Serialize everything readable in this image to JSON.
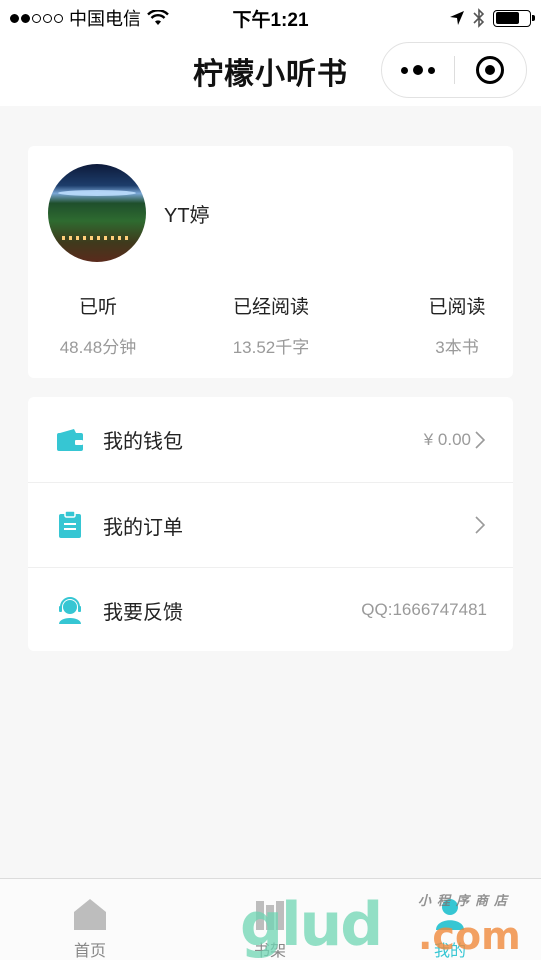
{
  "status_bar": {
    "carrier": "中国电信",
    "time": "下午1:21"
  },
  "nav": {
    "title": "柠檬小听书"
  },
  "profile": {
    "username": "YT婷",
    "stats": [
      {
        "label": "已听",
        "value": "48.48分钟"
      },
      {
        "label": "已经阅读",
        "value": "13.52千字"
      },
      {
        "label": "已阅读",
        "value": "3本书"
      }
    ]
  },
  "menu": {
    "items": [
      {
        "label": "我的钱包",
        "value": "¥ 0.00",
        "icon": "wallet-icon"
      },
      {
        "label": "我的订单",
        "value": "",
        "icon": "clipboard-icon"
      },
      {
        "label": "我要反馈",
        "value": "QQ:1666747481",
        "icon": "headset-user-icon"
      }
    ]
  },
  "tabs": [
    {
      "label": "首页",
      "icon": "home-icon",
      "active": false
    },
    {
      "label": "书架",
      "icon": "bookshelf-icon",
      "active": false
    },
    {
      "label": "我的",
      "icon": "user-icon",
      "active": true
    }
  ],
  "watermark": {
    "main": "glud",
    "domain": ".com",
    "small": "小程序商店"
  },
  "colors": {
    "accent": "#36c6d3",
    "background": "#f7f7f7",
    "card": "#ffffff",
    "muted_text": "#9a9a9a"
  }
}
